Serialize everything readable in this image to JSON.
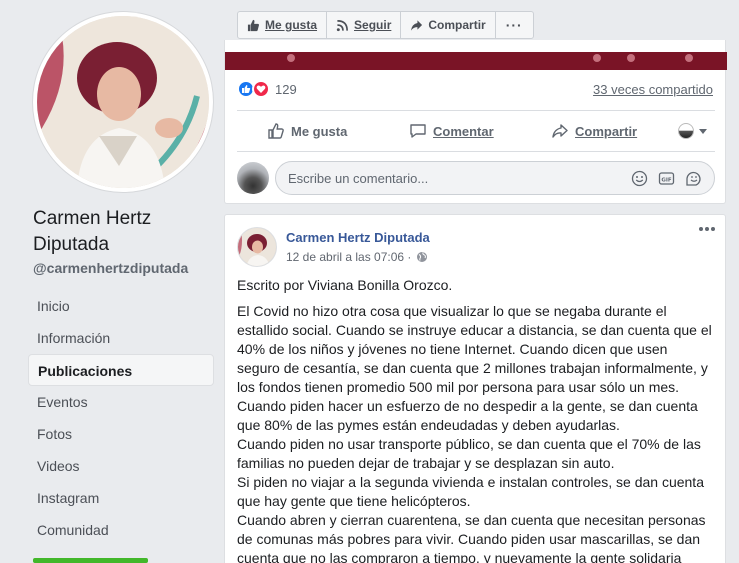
{
  "sidebar": {
    "page_name": "Carmen Hertz Diputada",
    "handle": "@carmenhertzdiputada",
    "nav": [
      {
        "label": "Inicio"
      },
      {
        "label": "Información"
      },
      {
        "label": "Publicaciones",
        "active": true
      },
      {
        "label": "Eventos"
      },
      {
        "label": "Fotos"
      },
      {
        "label": "Videos"
      },
      {
        "label": "Instagram"
      },
      {
        "label": "Comunidad"
      }
    ]
  },
  "topbar": {
    "like_label": "Me gusta",
    "follow_label": "Seguir",
    "share_label": "Compartir",
    "more_label": "···"
  },
  "prev_post": {
    "reaction_count": "129",
    "shares_text": "33 veces compartido",
    "actions": {
      "like": "Me gusta",
      "comment": "Comentar",
      "share": "Compartir"
    },
    "comment_placeholder": "Escribe un comentario..."
  },
  "post": {
    "author": "Carmen Hertz Diputada",
    "timestamp": "12 de abril a las 07:06 ·",
    "intro": "Escrito por Viviana Bonilla Orozco.",
    "body_lines": [
      "El Covid no hizo otra cosa que visualizar lo que se negaba durante el",
      "estallido social. Cuando se instruye educar a distancia, se dan cuenta que el",
      "40% de los niños y jóvenes no tiene Internet. Cuando dicen que usen",
      "seguro de cesantía, se dan cuenta que 2 millones trabajan informalmente, y",
      "los fondos tienen promedio 500 mil por persona para usar sólo un mes.",
      "Cuando piden hacer un esfuerzo de no despedir a la gente, se dan cuenta",
      "que 80% de las pymes están endeudadas y deben ayudarlas.",
      "Cuando piden no usar transporte público, se dan cuenta que el 70% de las",
      "familias no pueden dejar de trabajar y se desplazan sin auto.",
      "Si piden no viajar a la segunda vivienda e instalan controles, se dan cuenta",
      "que hay gente que tiene helicópteros.",
      "Cuando abren y cierran cuarentena, se dan cuenta que necesitan personas",
      "de comunas más pobres para vivir. Cuando piden usar mascarillas, se dan",
      "cuenta que no las compraron a tiempo, y nuevamente la gente solidaria"
    ]
  },
  "colors": {
    "background": "#e9ebee",
    "link": "#385898",
    "like_blue": "#1877f2",
    "love_red": "#f0284a",
    "video_strip": "#7a1426",
    "active_green": "#42b72a"
  }
}
